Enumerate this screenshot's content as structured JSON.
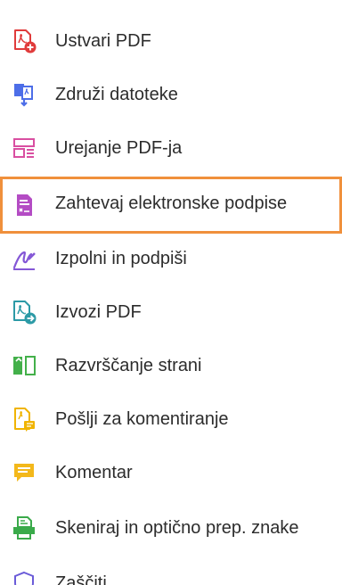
{
  "tools": [
    {
      "label": "Ustvari PDF",
      "icon": "create-pdf-icon",
      "color": "#e03b3b"
    },
    {
      "label": "Združi datoteke",
      "icon": "combine-files-icon",
      "color": "#4d6ee8"
    },
    {
      "label": "Urejanje PDF-ja",
      "icon": "edit-pdf-icon",
      "color": "#d94fa1"
    },
    {
      "label": "Zahtevaj elektronske podpise",
      "icon": "request-signatures-icon",
      "color": "#b44cc4",
      "selected": true
    },
    {
      "label": "Izpolni in podpiši",
      "icon": "fill-sign-icon",
      "color": "#8457d6"
    },
    {
      "label": "Izvozi PDF",
      "icon": "export-pdf-icon",
      "color": "#2c9aa6"
    },
    {
      "label": "Razvrščanje strani",
      "icon": "organize-pages-icon",
      "color": "#43b04a"
    },
    {
      "label": "Pošlji za komentiranje",
      "icon": "send-for-comments-icon",
      "color": "#f0b400"
    },
    {
      "label": "Komentar",
      "icon": "comment-icon",
      "color": "#f3b81b"
    },
    {
      "label": "Skeniraj in optično prep. znake",
      "icon": "scan-ocr-icon",
      "color": "#3aaa4a"
    },
    {
      "label": "Zaščiti",
      "icon": "protect-icon",
      "color": "#6a5bd8"
    }
  ],
  "selection_color": "#f0903c"
}
